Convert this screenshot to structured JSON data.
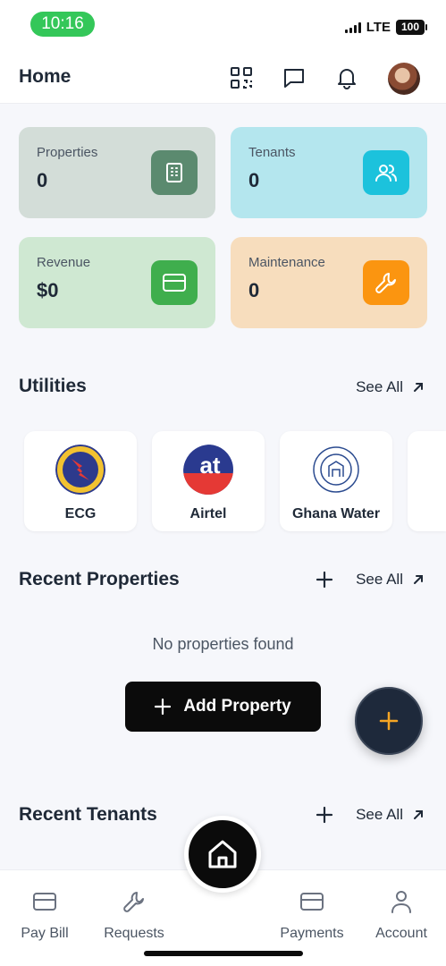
{
  "status_bar": {
    "time": "10:16",
    "network": "LTE",
    "battery": "100"
  },
  "header": {
    "title": "Home",
    "icons": [
      "qr-code-icon",
      "chat-icon",
      "bell-icon"
    ],
    "avatar": "avatar"
  },
  "stats": [
    {
      "label": "Properties",
      "value": "0",
      "icon": "building-icon",
      "bg": "#d3ddd8",
      "icon_bg": "#5b8a6f"
    },
    {
      "label": "Tenants",
      "value": "0",
      "icon": "users-icon",
      "bg": "#b4e6ee",
      "icon_bg": "#1cc2dc"
    },
    {
      "label": "Revenue",
      "value": "$0",
      "icon": "card-icon",
      "bg": "#cfe8d2",
      "icon_bg": "#3fae4d"
    },
    {
      "label": "Maintenance",
      "value": "0",
      "icon": "wrench-icon",
      "bg": "#f7ddbd",
      "icon_bg": "#fb9510"
    }
  ],
  "utilities": {
    "title": "Utilities",
    "see_all": "See All",
    "items": [
      {
        "name": "ECG",
        "logo": "ecg-logo"
      },
      {
        "name": "Airtel",
        "logo": "airtel-logo",
        "logo_text": "at"
      },
      {
        "name": "Ghana Water",
        "logo": "ghana-water-logo"
      }
    ]
  },
  "recent_properties": {
    "title": "Recent Properties",
    "see_all": "See All",
    "empty_text": "No properties found",
    "add_button": "Add Property"
  },
  "recent_tenants": {
    "title": "Recent Tenants",
    "see_all": "See All"
  },
  "bottom_nav": [
    {
      "label": "Pay Bill",
      "icon": "card-icon"
    },
    {
      "label": "Requests",
      "icon": "wrench-icon"
    },
    {
      "label": "Payments",
      "icon": "card-icon"
    },
    {
      "label": "Account",
      "icon": "user-icon"
    }
  ],
  "colors": {
    "accent": "#0b0b0b",
    "fab": "#1e293b",
    "fab_plus": "#f5a524"
  }
}
